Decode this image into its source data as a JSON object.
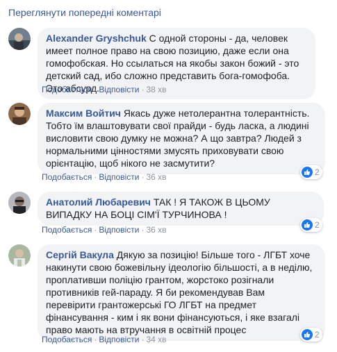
{
  "prev_comments_link": "Переглянути попередні коментарі",
  "actions": {
    "like": "Подобається",
    "reply": "Відповісти",
    "separator": "·"
  },
  "comments": [
    {
      "author": "Alexander Gryshchuk",
      "text": "С одной стороны - да, человек имеет полное право на свою позицию, даже если она гомофобская. Но ссылаться на якобы закон божий - это детский сад, ибо сложно представить бога-гомофоба. Это абсурд.",
      "time": "38 хв",
      "reactions": ""
    },
    {
      "author": "Максим Войтич",
      "text": "Якась дуже нетолерантна толерантність. Тобто їм влаштовувати свої прайди - будь ласка, а людині висловити свою думку не можна? А що завтра? Людей з нормальними цінностями змусять приховувати свою орієнтацію, щоб нікого не засмутити?",
      "time": "36 хв",
      "reactions": "2"
    },
    {
      "author": "Анатолий Любаревич",
      "text": "ТАК ! Я ТАКОЖ В ЦЬОМУ ВИПАДКУ НА БОЦІ СІМ'Ї ТУРЧИНОВА !",
      "time": "36 хв",
      "reactions": "2"
    },
    {
      "author": "Сергій Вакула",
      "text": "Дякую за позицію! Більше того - ЛГБТ хоче накинути свою божевільну ідеологію більшості, а в неділю, проплативши поліцію грантом, жорстоко розігнали противників гей-параду. Я би рекомендував Вам перевірити грантожерські ГО ЛГБТ на предмет фінансування - ким і як вони фінансуються, і яке взагалі право мають на втручання в освітній процес",
      "time": "34 хв",
      "reactions": "2"
    }
  ],
  "colors": {
    "link": "#385898",
    "bubble": "#f2f3f5",
    "meta": "#90949c",
    "like": "#1877f2"
  }
}
